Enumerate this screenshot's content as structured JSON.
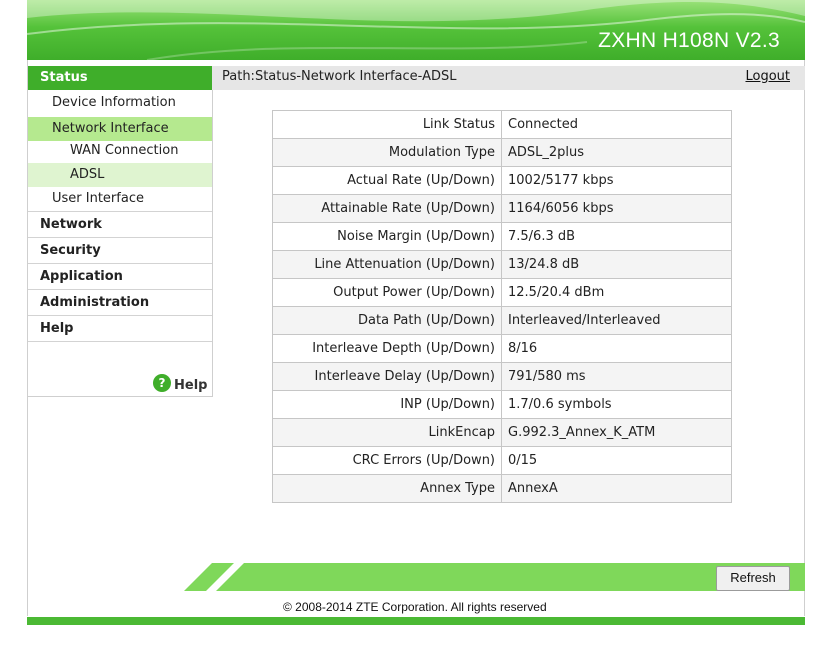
{
  "header": {
    "model": "ZXHN H108N V2.3"
  },
  "sidebar": {
    "status_label": "Status",
    "status_sub": [
      {
        "label": "Device Information"
      },
      {
        "label": "Network Interface"
      },
      {
        "label": "WAN Connection"
      },
      {
        "label": "ADSL"
      },
      {
        "label": "User Interface"
      }
    ],
    "main_items": [
      {
        "label": "Network"
      },
      {
        "label": "Security"
      },
      {
        "label": "Application"
      },
      {
        "label": "Administration"
      },
      {
        "label": "Help"
      }
    ],
    "help_link": "Help",
    "help_icon": "?"
  },
  "pathbar": {
    "path": "Path:Status-Network Interface-ADSL",
    "logout": "Logout"
  },
  "adsl_table": [
    {
      "key": "Link Status",
      "value": "Connected"
    },
    {
      "key": "Modulation Type",
      "value": "ADSL_2plus"
    },
    {
      "key": "Actual Rate (Up/Down)",
      "value": "1002/5177 kbps"
    },
    {
      "key": "Attainable Rate (Up/Down)",
      "value": "1164/6056 kbps"
    },
    {
      "key": "Noise Margin (Up/Down)",
      "value": "7.5/6.3 dB"
    },
    {
      "key": "Line Attenuation (Up/Down)",
      "value": "13/24.8 dB"
    },
    {
      "key": "Output Power (Up/Down)",
      "value": "12.5/20.4 dBm"
    },
    {
      "key": "Data Path (Up/Down)",
      "value": "Interleaved/Interleaved"
    },
    {
      "key": "Interleave Depth (Up/Down)",
      "value": "8/16"
    },
    {
      "key": "Interleave Delay (Up/Down)",
      "value": "791/580 ms"
    },
    {
      "key": "INP (Up/Down)",
      "value": "1.7/0.6 symbols"
    },
    {
      "key": "LinkEncap",
      "value": "G.992.3_Annex_K_ATM"
    },
    {
      "key": "CRC Errors (Up/Down)",
      "value": "0/15"
    },
    {
      "key": "Annex Type",
      "value": "AnnexA"
    }
  ],
  "footer": {
    "refresh_label": "Refresh",
    "copyright": "© 2008-2014 ZTE Corporation. All rights reserved"
  },
  "colors": {
    "brand_green": "#3fae2a",
    "active_sub": "#b5e98f",
    "active_sub2": "#dff4d0"
  }
}
